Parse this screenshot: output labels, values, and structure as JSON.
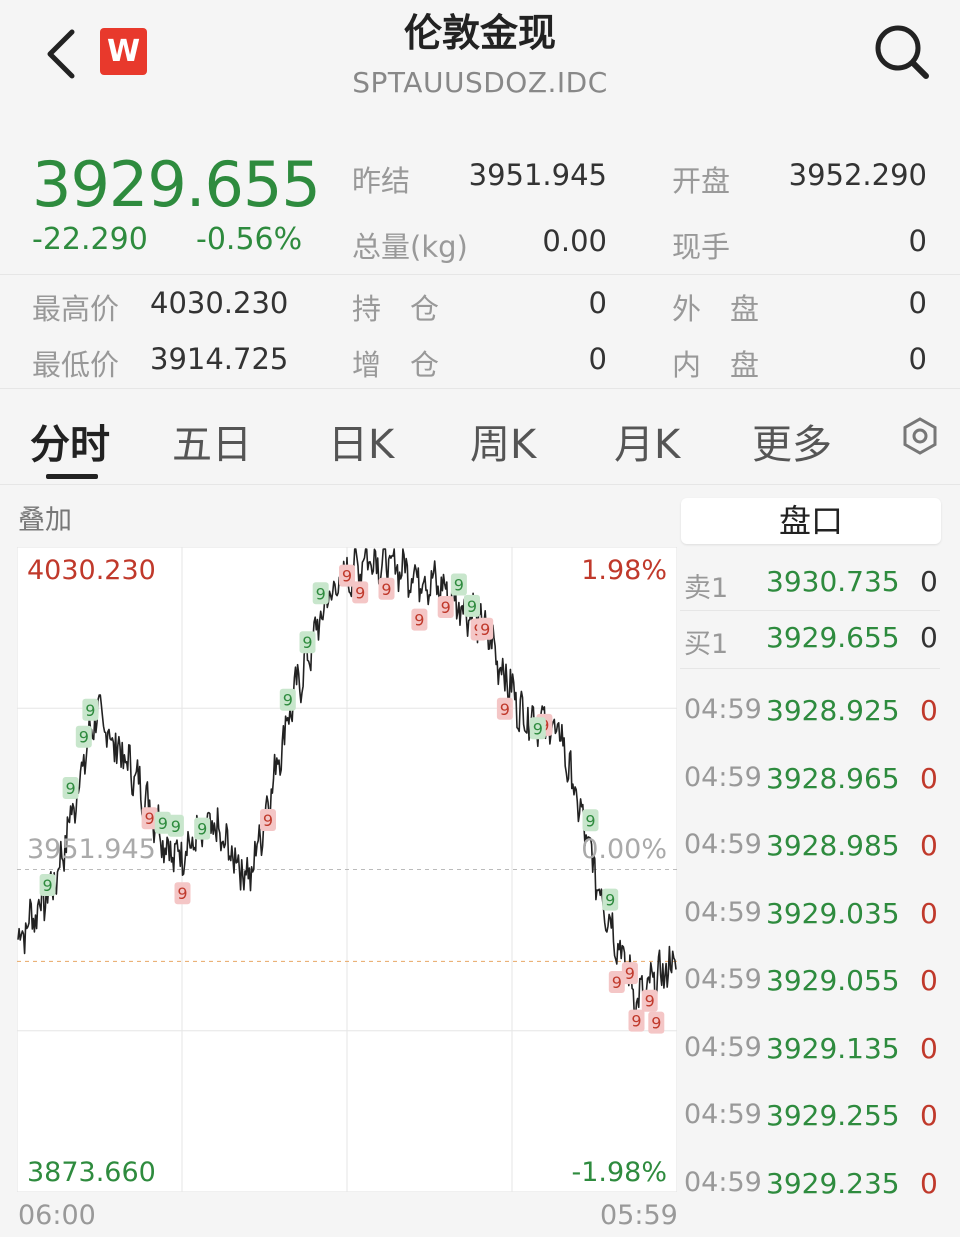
{
  "header": {
    "title": "伦敦金现",
    "subtitle": "SPTAUUSDOZ.IDC",
    "logo_letter": "W"
  },
  "quote": {
    "price": "3929.655",
    "change": "-22.290",
    "change_pct": "-0.56%",
    "rows": [
      {
        "l1": "昨结",
        "v1": "3951.945",
        "l2": "开盘",
        "v2": "3952.290"
      },
      {
        "l1": "总量(kg)",
        "v1": "0.00",
        "l2": "现手",
        "v2": "0"
      }
    ],
    "stats": [
      {
        "l0": "最高价",
        "v0": "4030.230",
        "l1": "持　仓",
        "v1": "0",
        "l2": "外　盘",
        "v2": "0"
      },
      {
        "l0": "最低价",
        "v0": "3914.725",
        "l1": "增　仓",
        "v1": "0",
        "l2": "内　盘",
        "v2": "0"
      }
    ]
  },
  "tabs": [
    "分时",
    "五日",
    "日K",
    "周K",
    "月K",
    "更多"
  ],
  "chart": {
    "overlay_label": "叠加",
    "time_start": "06:00",
    "time_end": "05:59"
  },
  "chart_data": {
    "type": "line",
    "y_max_label": "4030.230",
    "y_mid_label": "3951.945",
    "y_min_label": "3873.660",
    "pct_max_label": "1.98%",
    "pct_mid_label": "0.00%",
    "pct_min_label": "-1.98%",
    "ylim": [
      3873.66,
      4030.23
    ],
    "reference_price": 3951.945,
    "last_price": 3929.655,
    "x": [
      "06:00",
      "07:30",
      "09:00",
      "10:30",
      "12:00",
      "13:30",
      "15:00",
      "16:30",
      "18:00",
      "19:30",
      "21:00",
      "22:30",
      "00:00",
      "01:30",
      "03:00",
      "04:00",
      "05:00",
      "05:59"
    ],
    "values": [
      3935,
      3950,
      3990,
      3975,
      3955,
      3962,
      3950,
      3990,
      4018,
      4028,
      4025,
      4020,
      4012,
      3990,
      3985,
      3948,
      3920,
      3930
    ],
    "colors": {
      "line": "#222222",
      "up": "#c0392b",
      "down": "#2e8b3e"
    }
  },
  "order_book": {
    "title": "盘口",
    "levels": [
      {
        "label": "卖1",
        "price": "3930.735",
        "vol": "0"
      },
      {
        "label": "买1",
        "price": "3929.655",
        "vol": "0"
      }
    ],
    "trades": [
      {
        "time": "04:59",
        "price": "3928.925",
        "vol": "0"
      },
      {
        "time": "04:59",
        "price": "3928.965",
        "vol": "0"
      },
      {
        "time": "04:59",
        "price": "3928.985",
        "vol": "0"
      },
      {
        "time": "04:59",
        "price": "3929.035",
        "vol": "0"
      },
      {
        "time": "04:59",
        "price": "3929.055",
        "vol": "0"
      },
      {
        "time": "04:59",
        "price": "3929.135",
        "vol": "0"
      },
      {
        "time": "04:59",
        "price": "3929.255",
        "vol": "0"
      },
      {
        "time": "04:59",
        "price": "3929.235",
        "vol": "0"
      }
    ]
  }
}
